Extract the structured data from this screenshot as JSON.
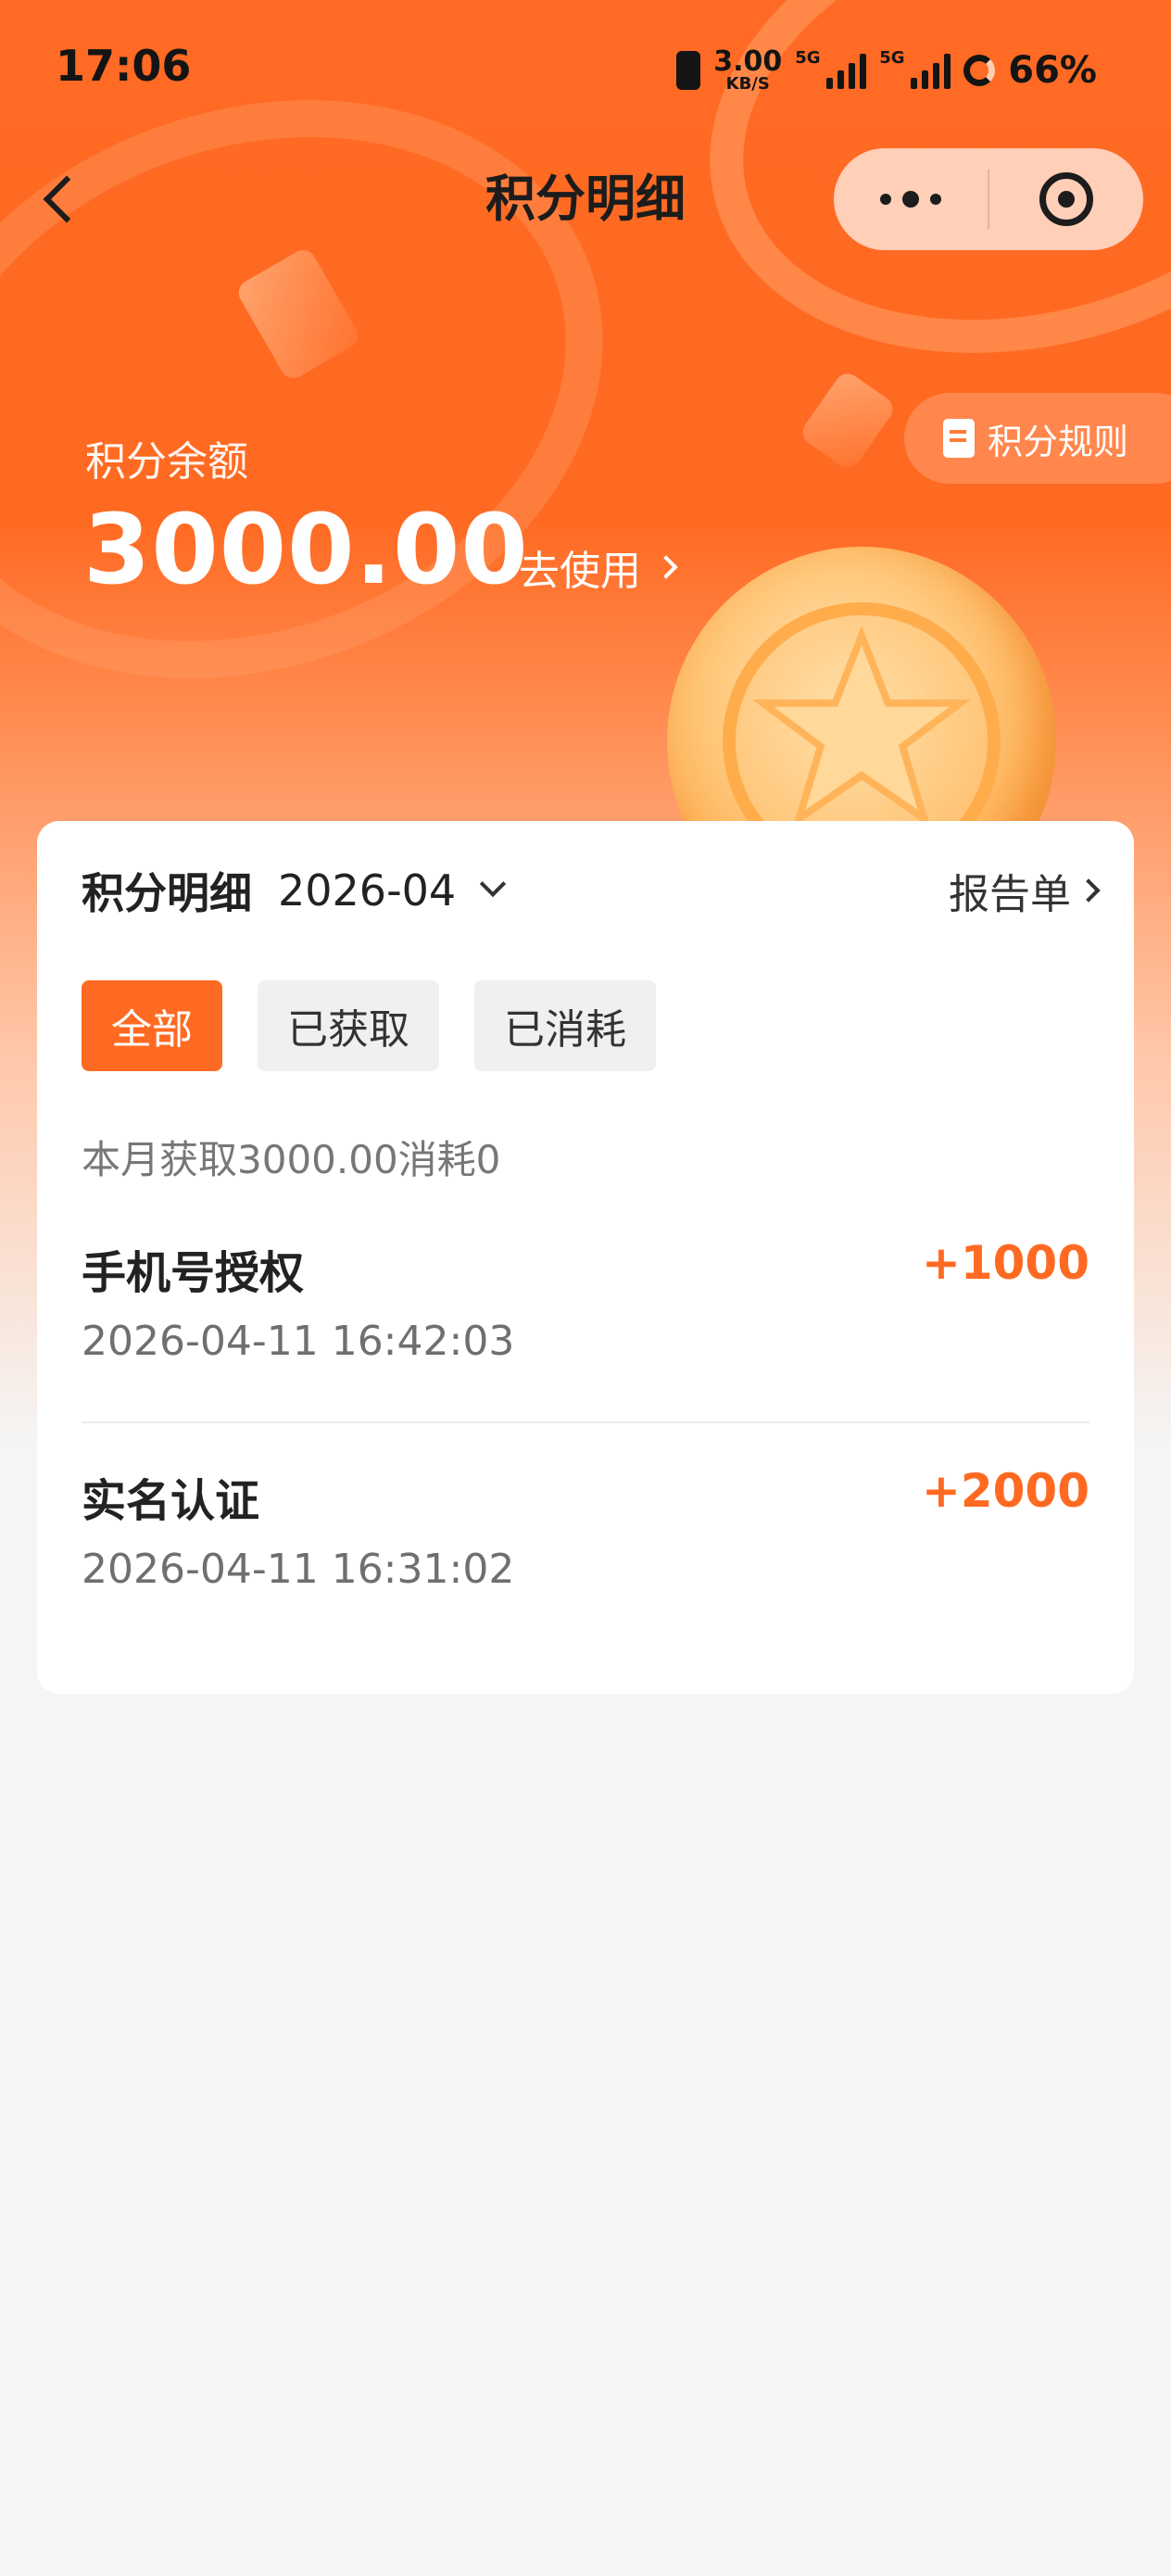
{
  "status_bar": {
    "time": "17:06",
    "net_speed": "3.00",
    "net_speed_unit": "KB/S",
    "sim1_tag": "5G",
    "sim2_tag": "5G",
    "battery": "66%"
  },
  "nav": {
    "title": "积分明细",
    "back_icon": "chevron-left-icon",
    "more_icon": "more-dots-icon",
    "close_icon": "target-icon"
  },
  "hero": {
    "balance_label": "积分余额",
    "balance_value": "3000.00",
    "use_link": "去使用",
    "rules_button": "积分规则"
  },
  "detail": {
    "title": "积分明细",
    "month": "2026-04",
    "report_link": "报告单",
    "tabs": [
      {
        "label": "全部",
        "active": true
      },
      {
        "label": "已获取",
        "active": false
      },
      {
        "label": "已消耗",
        "active": false
      }
    ],
    "summary": "本月获取3000.00消耗0",
    "records": [
      {
        "name": "手机号授权",
        "time": "2026-04-11 16:42:03",
        "points": "+1000"
      },
      {
        "name": "实名认证",
        "time": "2026-04-11 16:31:02",
        "points": "+2000"
      }
    ]
  },
  "colors": {
    "accent": "#ff6a22",
    "card_bg": "#ffffff",
    "page_bg": "#f5f5f5"
  }
}
